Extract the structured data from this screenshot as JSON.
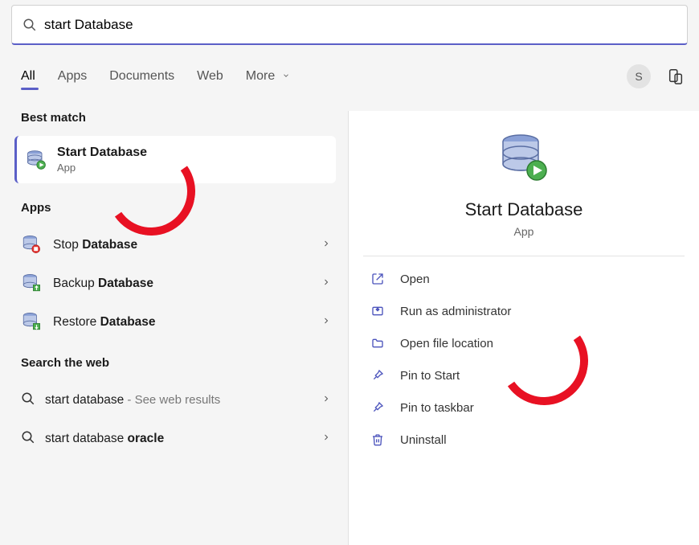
{
  "search": {
    "placeholder": "",
    "value": "start Database"
  },
  "tabs": {
    "all": "All",
    "apps": "Apps",
    "documents": "Documents",
    "web": "Web",
    "more": "More"
  },
  "avatar_initial": "S",
  "left": {
    "best_match_header": "Best match",
    "best_match": {
      "title": "Start Database",
      "subtitle": "App"
    },
    "apps_header": "Apps",
    "apps": [
      {
        "prefix": "Stop ",
        "bold": "Database"
      },
      {
        "prefix": "Backup ",
        "bold": "Database"
      },
      {
        "prefix": "Restore ",
        "bold": "Database"
      }
    ],
    "web_header": "Search the web",
    "web": [
      {
        "main": "start database",
        "suffix": " - See web results"
      },
      {
        "main_prefix": "start database ",
        "main_bold": "oracle",
        "suffix": ""
      }
    ]
  },
  "right": {
    "title": "Start Database",
    "subtitle": "App",
    "actions": {
      "open": "Open",
      "run_admin": "Run as administrator",
      "open_loc": "Open file location",
      "pin_start": "Pin to Start",
      "pin_taskbar": "Pin to taskbar",
      "uninstall": "Uninstall"
    }
  }
}
